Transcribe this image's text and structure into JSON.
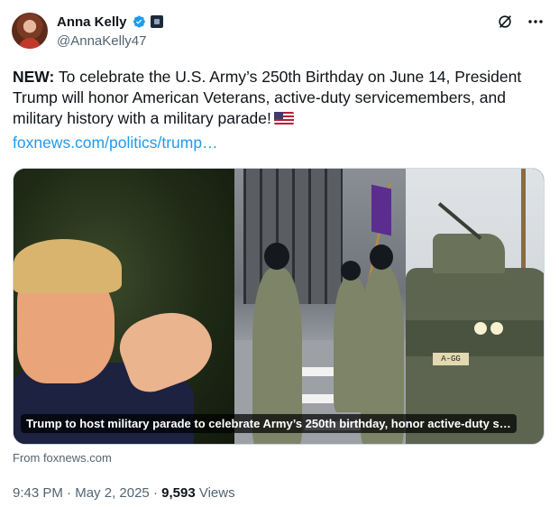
{
  "author": {
    "display_name": "Anna Kelly",
    "handle": "@AnnaKelly47",
    "verified": true,
    "verified_color": "#1d9bf0"
  },
  "tweet": {
    "prefix": "NEW:",
    "text": " To celebrate the U.S. Army’s 250th Birthday on June 14, President Trump will honor American Veterans, active-duty servicemembers, and military history with a military parade!",
    "emoji": "us-flag",
    "link": "foxnews.com/politics/trump…"
  },
  "card": {
    "caption": "Trump to host military parade to celebrate Army’s 250th birthday, honor active-duty s…",
    "plate": "A-GG",
    "source": "From foxnews.com"
  },
  "meta": {
    "time": "9:43 PM",
    "date": "May 2, 2025",
    "views_count": "9,593",
    "views_label": "Views"
  },
  "icons": {
    "grok": "grok-icon",
    "more": "more-icon"
  },
  "colors": {
    "link": "#1d9bf0",
    "secondary_text": "#536471"
  }
}
